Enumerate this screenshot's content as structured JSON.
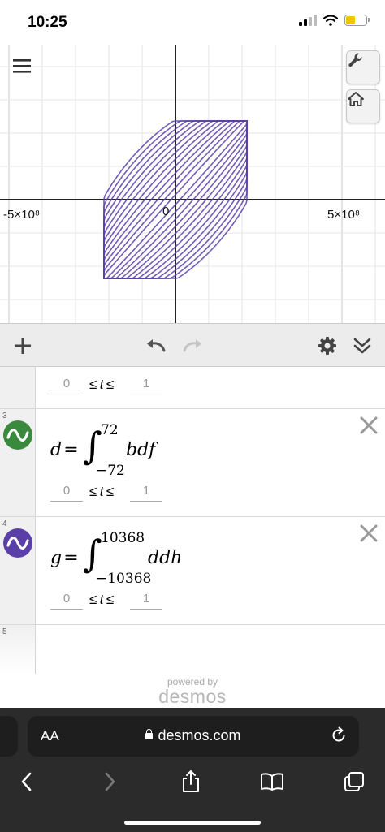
{
  "status_bar": {
    "time": "10:25",
    "battery_level": 0.45
  },
  "graph": {
    "x_tick_left": "-5×10⁸",
    "x_tick_right": "5×10⁸",
    "origin_label": "0",
    "curve_color": "#5b3fa8",
    "buttons": {
      "settings_icon": "wrench-icon",
      "home_icon": "home-icon",
      "menu_icon": "hamburger-menu-icon"
    }
  },
  "toolbar": {
    "add_icon": "plus-icon",
    "undo_icon": "undo-icon",
    "redo_icon": "redo-icon",
    "settings_icon": "gear-icon",
    "collapse_icon": "double-chevron-down-icon"
  },
  "expressions": [
    {
      "index": "",
      "domain_min": "0",
      "domain_max": "1",
      "domain_var": "t"
    },
    {
      "index": "3",
      "color": "#3a8a3e",
      "lhs": "d",
      "upper": "72",
      "lower": "−72",
      "integrand": "bdf",
      "domain_min": "0",
      "domain_max": "1",
      "domain_var": "t"
    },
    {
      "index": "4",
      "color": "#5b3fa8",
      "lhs": "g",
      "upper": "10368",
      "lower": "−10368",
      "integrand": "ddh",
      "domain_min": "0",
      "domain_max": "1",
      "domain_var": "t"
    },
    {
      "index": "5"
    }
  ],
  "branding": {
    "powered_by": "powered by",
    "brand": "desmos"
  },
  "safari": {
    "aa_label": "AA",
    "url": "desmos.com"
  }
}
